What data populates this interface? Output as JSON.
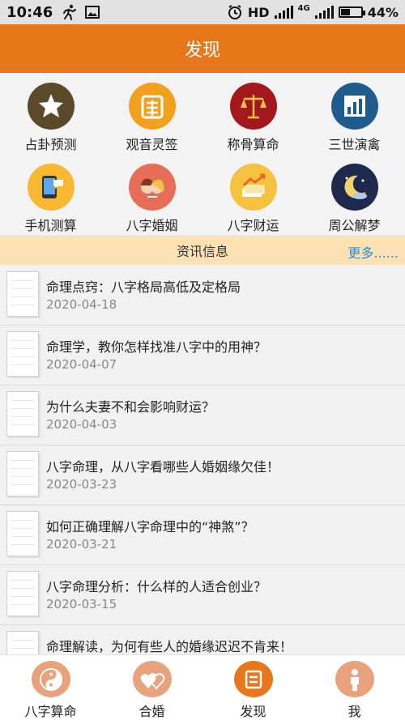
{
  "status_bar": {
    "time": "10:46",
    "network": "HD",
    "lte": "4G",
    "battery": "44%",
    "battery_level": 0.44
  },
  "header": {
    "title": "发现"
  },
  "features": [
    {
      "label": "占卦预测",
      "icon": "star-icon",
      "color": "#5a4a2a"
    },
    {
      "label": "观音灵签",
      "icon": "sign-stick-icon",
      "color": "#f3a01e"
    },
    {
      "label": "称骨算命",
      "icon": "scale-icon",
      "color": "#a2181c"
    },
    {
      "label": "三世演禽",
      "icon": "bar-chart-icon",
      "color": "#1f5c8d"
    },
    {
      "label": "手机测算",
      "icon": "phone-icon",
      "color": "#f7b731"
    },
    {
      "label": "八字婚姻",
      "icon": "couple-icon",
      "color": "#e86d58"
    },
    {
      "label": "八字财运",
      "icon": "money-trend-icon",
      "color": "#f4c23f"
    },
    {
      "label": "周公解梦",
      "icon": "moon-icon",
      "color": "#1e2a4d"
    }
  ],
  "news_section": {
    "title": "资讯信息",
    "more_label": "更多......"
  },
  "news": [
    {
      "title": "命理点窍：八字格局高低及定格局",
      "date": "2020-04-18"
    },
    {
      "title": "命理学，教你怎样找准八字中的用神？",
      "date": "2020-04-07"
    },
    {
      "title": "为什么夫妻不和会影响财运？",
      "date": "2020-04-03"
    },
    {
      "title": "八字命理，从八字看哪些人婚姻缘欠佳！",
      "date": "2020-03-23"
    },
    {
      "title": "如何正确理解八字命理中的“神煞”？",
      "date": "2020-03-21"
    },
    {
      "title": "八字命理分析：什么样的人适合创业？",
      "date": "2020-03-15"
    },
    {
      "title": "命理解读，为何有些人的婚缘迟迟不肯来！",
      "date": ""
    }
  ],
  "bottom_nav": [
    {
      "label": "八字算命",
      "icon": "yin-yang-icon",
      "color": "#e8a27c"
    },
    {
      "label": "合婚",
      "icon": "hearts-icon",
      "color": "#e8a27c"
    },
    {
      "label": "发现",
      "icon": "discover-icon",
      "color": "#e8761b",
      "active": true
    },
    {
      "label": "我",
      "icon": "person-icon",
      "color": "#e8a27c"
    }
  ]
}
